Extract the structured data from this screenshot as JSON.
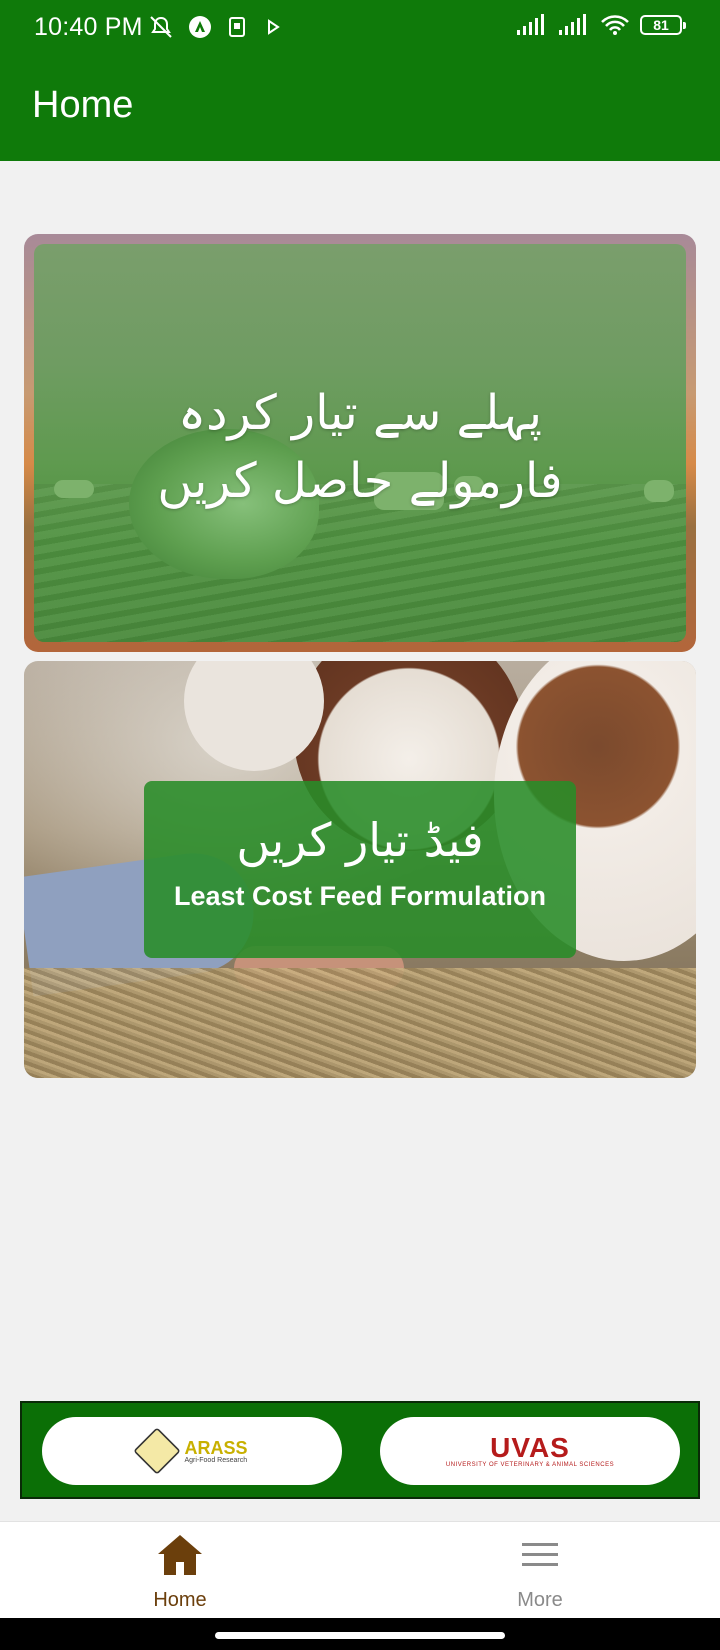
{
  "status_bar": {
    "time": "10:40 PM",
    "battery": "81"
  },
  "app_bar": {
    "title": "Home"
  },
  "cards": [
    {
      "title_urdu": "پہلے سے تیار کردہ فارمولے حاصل کریں"
    },
    {
      "title_urdu": "فیڈ تیار کریں",
      "title_en": "Least Cost Feed Formulation"
    }
  ],
  "sponsors": {
    "arass": {
      "name": "ARASS",
      "tagline": "Agri-Food Research"
    },
    "uvas": {
      "name": "UVAS",
      "tagline": "UNIVERSITY OF VETERINARY & ANIMAL SCIENCES"
    }
  },
  "bottom_nav": {
    "home_label": "Home",
    "more_label": "More"
  },
  "colors": {
    "primary": "#0f7a0a",
    "home_active": "#6b3f0c",
    "inactive": "#8a8a8a"
  }
}
